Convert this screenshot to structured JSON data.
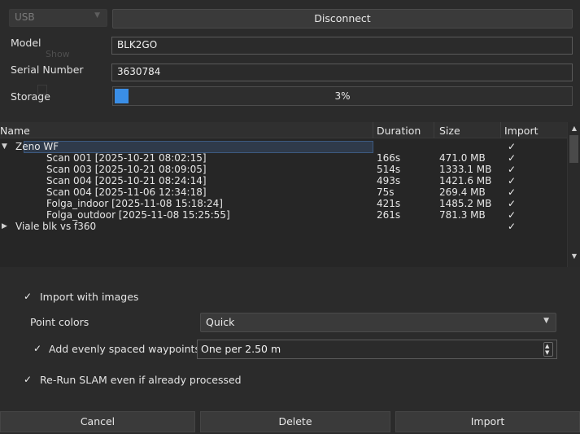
{
  "connection": {
    "port": "USB",
    "disconnect_label": "Disconnect"
  },
  "device": {
    "model_label": "Model",
    "model_value": "BLK2GO",
    "serial_label": "Serial Number",
    "serial_value": "3630784",
    "storage_label": "Storage",
    "storage_percent": 3,
    "storage_text": "3%",
    "ghost_text": "Show"
  },
  "tree": {
    "columns": [
      "Name",
      "Duration",
      "Size",
      "Import"
    ],
    "rows": [
      {
        "type": "group",
        "expanded": true,
        "name": "Zeno WF",
        "duration": "",
        "size": "",
        "import": "✓",
        "selected": true
      },
      {
        "type": "item",
        "name": "Scan 001 [2025-10-21 08:02:15]",
        "duration": "166s",
        "size": "471.0 MB",
        "import": "✓"
      },
      {
        "type": "item",
        "name": "Scan 003 [2025-10-21 08:09:05]",
        "duration": "514s",
        "size": "1333.1 MB",
        "import": "✓"
      },
      {
        "type": "item",
        "name": "Scan 004 [2025-10-21 08:24:14]",
        "duration": "493s",
        "size": "1421.6 MB",
        "import": "✓"
      },
      {
        "type": "item",
        "name": "Scan 004 [2025-11-06 12:34:18]",
        "duration": "75s",
        "size": "269.4 MB",
        "import": "✓"
      },
      {
        "type": "item",
        "name": "Folga_indoor [2025-11-08 15:18:24]",
        "duration": "421s",
        "size": "1485.2 MB",
        "import": "✓"
      },
      {
        "type": "item",
        "name": "Folga_outdoor [2025-11-08 15:25:55]",
        "duration": "261s",
        "size": "781.3 MB",
        "import": "✓"
      },
      {
        "type": "group",
        "expanded": false,
        "name": "Viale blk vs f360",
        "duration": "",
        "size": "",
        "import": "✓"
      }
    ]
  },
  "options": {
    "import_images_label": "Import with images",
    "point_colors_label": "Point colors",
    "point_colors_value": "Quick",
    "waypoints_label": "Add evenly spaced waypoints",
    "waypoints_value": "One per 2.50 m",
    "rerun_slam_label": "Re-Run SLAM even if already processed",
    "check_glyph": "✓"
  },
  "footer": {
    "cancel_label": "Cancel",
    "delete_label": "Delete",
    "import_label": "Import"
  },
  "colors": {
    "accent": "#3a8ee6",
    "background": "#2b2b2b"
  }
}
